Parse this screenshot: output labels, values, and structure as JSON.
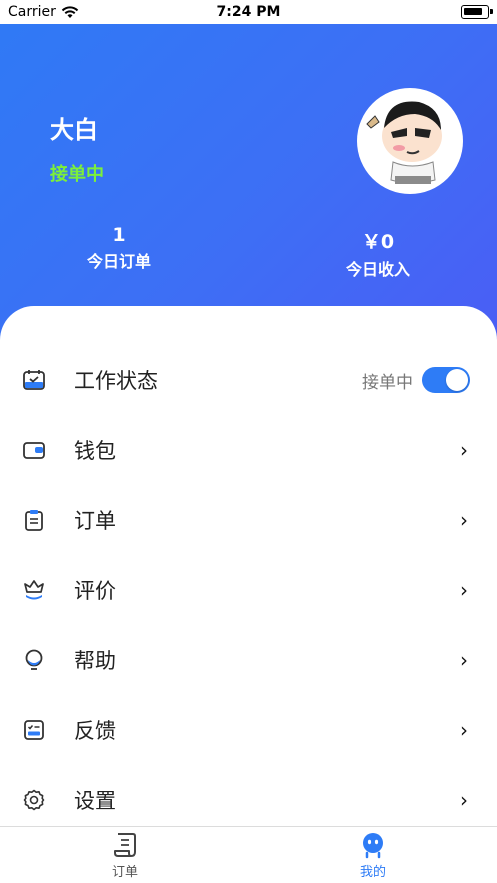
{
  "status_bar": {
    "carrier": "Carrier",
    "time": "7:24 PM"
  },
  "profile": {
    "name": "大白",
    "status": "接单中"
  },
  "stats": {
    "orders": {
      "value": "1",
      "label": "今日订单"
    },
    "income": {
      "value": "￥0",
      "label": "今日收入"
    }
  },
  "menu": {
    "work_status": {
      "label": "工作状态",
      "toggle_text": "接单中",
      "toggle_on": true
    },
    "wallet": {
      "label": "钱包"
    },
    "orders": {
      "label": "订单"
    },
    "review": {
      "label": "评价"
    },
    "help": {
      "label": "帮助"
    },
    "feedback": {
      "label": "反馈"
    },
    "settings": {
      "label": "设置"
    },
    "chevron": "›"
  },
  "tabs": {
    "orders": "订单",
    "mine": "我的"
  },
  "colors": {
    "accent": "#2e7cf6",
    "status_green": "#7cf03a",
    "header_start": "#2f7af5",
    "header_end": "#4a5ef5"
  }
}
